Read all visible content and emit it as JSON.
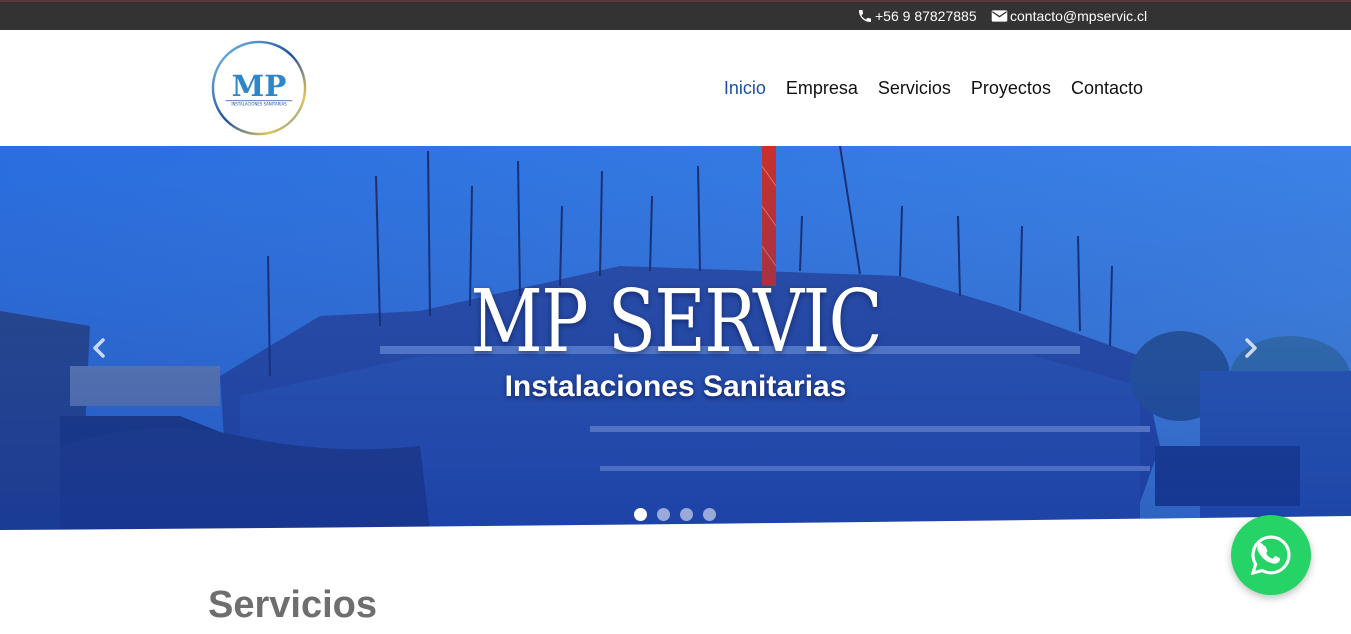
{
  "topbar": {
    "phone": "+56 9 87827885",
    "email": "contacto@mpservic.cl",
    "phone_icon": "phone-icon",
    "email_icon": "envelope-icon"
  },
  "logo": {
    "initials": "MP",
    "tagline": "INSTALACIONES SANITARIAS"
  },
  "nav": {
    "items": [
      {
        "label": "Inicio",
        "active": true
      },
      {
        "label": "Empresa",
        "active": false
      },
      {
        "label": "Servicios",
        "active": false
      },
      {
        "label": "Proyectos",
        "active": false
      },
      {
        "label": "Contacto",
        "active": false
      }
    ]
  },
  "hero": {
    "title": "MP SERVIC",
    "subtitle": "Instalaciones Sanitarias",
    "prev_icon": "chevron-left-icon",
    "next_icon": "chevron-right-icon",
    "slides_count": 4,
    "active_slide": 1
  },
  "section": {
    "title": "Servicios"
  },
  "colors": {
    "topbar_bg": "#333333",
    "nav_active": "#1d4f9c",
    "hero_blue": "#1a4fc4",
    "whatsapp_green": "#25d366"
  },
  "whatsapp": {
    "icon": "whatsapp-icon"
  }
}
